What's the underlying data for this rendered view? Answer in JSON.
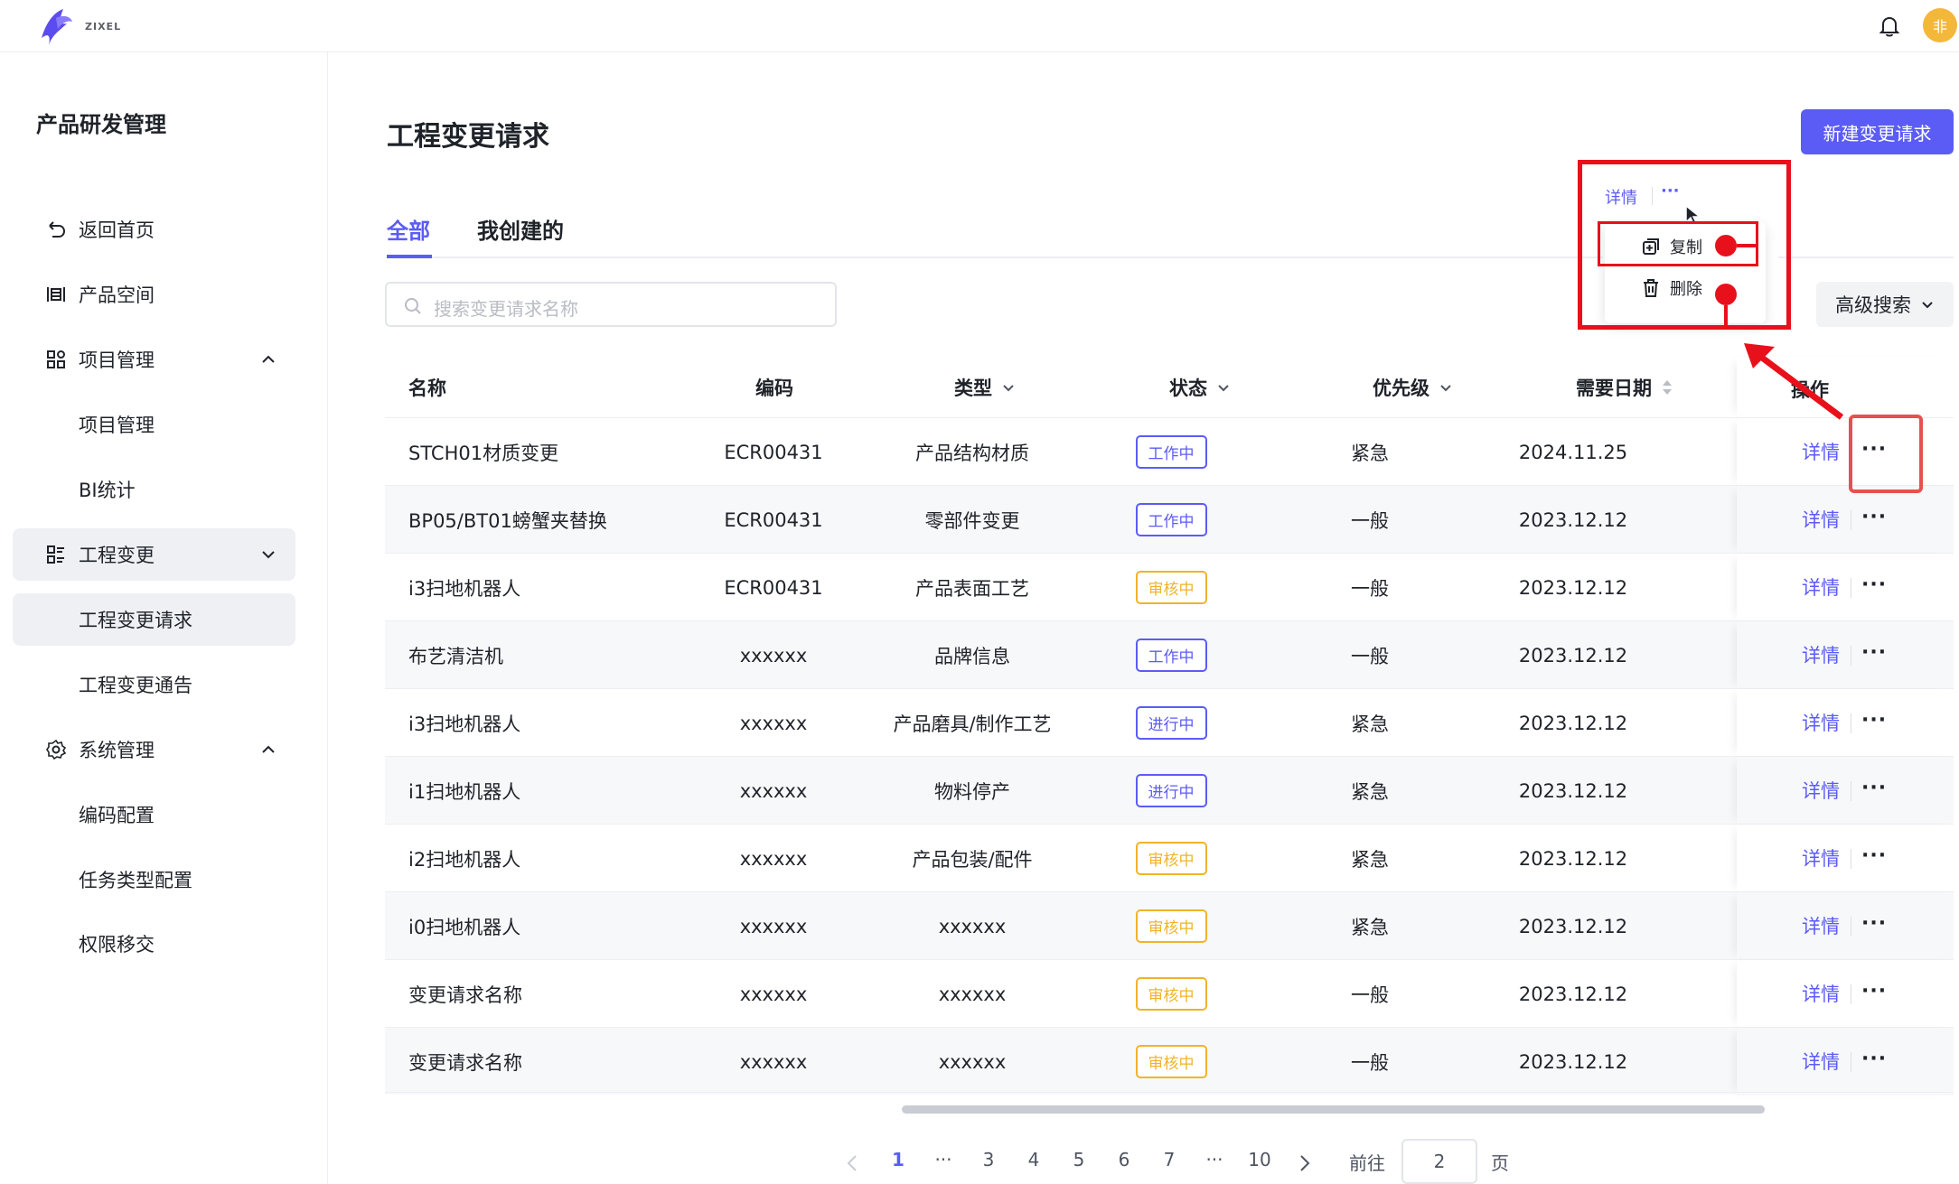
{
  "header": {
    "logo_text": "ZIXEL",
    "avatar_initial": "非"
  },
  "sidebar": {
    "title": "产品研发管理",
    "items": [
      {
        "label": "返回首页",
        "icon": "back-icon"
      },
      {
        "label": "产品空间",
        "icon": "product-space-icon"
      },
      {
        "label": "项目管理",
        "icon": "grid-icon",
        "expanded": true
      },
      {
        "label": "项目管理",
        "sub": true
      },
      {
        "label": "BI统计",
        "sub": true
      },
      {
        "label": "工程变更",
        "icon": "list-icon",
        "expanded": false
      },
      {
        "label": "工程变更请求",
        "sub": true,
        "active": true
      },
      {
        "label": "工程变更通告",
        "sub": true
      },
      {
        "label": "系统管理",
        "icon": "gear-icon",
        "expanded": true
      },
      {
        "label": "编码配置",
        "sub": true
      },
      {
        "label": "任务类型配置",
        "sub": true
      },
      {
        "label": "权限移交",
        "sub": true
      }
    ]
  },
  "main": {
    "title": "工程变更请求",
    "new_button": "新建变更请求",
    "tabs": [
      {
        "label": "全部",
        "active": true
      },
      {
        "label": "我创建的",
        "active": false
      }
    ],
    "search_placeholder": "搜索变更请求名称",
    "advanced_search": "高级搜索"
  },
  "table": {
    "columns": [
      "名称",
      "编码",
      "类型",
      "状态",
      "优先级",
      "需要日期",
      "操作"
    ],
    "rows": [
      {
        "name": "STCH01材质变更",
        "code": "ECR00431",
        "type": "产品结构材质",
        "status": "工作中",
        "priority": "紧急",
        "date": "2024.11.25"
      },
      {
        "name": "BP05/BT01螃蟹夹替换",
        "code": "ECR00431",
        "type": "零部件变更",
        "status": "工作中",
        "priority": "一般",
        "date": "2023.12.12"
      },
      {
        "name": "i3扫地机器人",
        "code": "ECR00431",
        "type": "产品表面工艺",
        "status": "审核中",
        "priority": "一般",
        "date": "2023.12.12"
      },
      {
        "name": "布艺清洁机",
        "code": "xxxxxx",
        "type": "品牌信息",
        "status": "工作中",
        "priority": "一般",
        "date": "2023.12.12"
      },
      {
        "name": "i3扫地机器人",
        "code": "xxxxxx",
        "type": "产品磨具/制作工艺",
        "status": "进行中",
        "priority": "紧急",
        "date": "2023.12.12"
      },
      {
        "name": "i1扫地机器人",
        "code": "xxxxxx",
        "type": "物料停产",
        "status": "进行中",
        "priority": "紧急",
        "date": "2023.12.12"
      },
      {
        "name": "i2扫地机器人",
        "code": "xxxxxx",
        "type": "产品包装/配件",
        "status": "审核中",
        "priority": "紧急",
        "date": "2023.12.12"
      },
      {
        "name": "i0扫地机器人",
        "code": "xxxxxx",
        "type": "xxxxxx",
        "status": "审核中",
        "priority": "紧急",
        "date": "2023.12.12"
      },
      {
        "name": "变更请求名称",
        "code": "xxxxxx",
        "type": "xxxxxx",
        "status": "审核中",
        "priority": "一般",
        "date": "2023.12.12"
      },
      {
        "name": "变更请求名称",
        "code": "xxxxxx",
        "type": "xxxxxx",
        "status": "审核中",
        "priority": "一般",
        "date": "2023.12.12"
      }
    ],
    "action_detail": "详情",
    "action_more": "···"
  },
  "status_colors": {
    "工作中": "#5b5cf6",
    "进行中": "#5b5cf6",
    "审核中": "#f0b429"
  },
  "pagination": {
    "pages": [
      "1",
      "···",
      "3",
      "4",
      "5",
      "6",
      "7",
      "···",
      "10"
    ],
    "current": "1",
    "goto_label": "前往",
    "goto_value": "2",
    "page_suffix": "页"
  },
  "popover": {
    "detail": "详情",
    "more": "···",
    "menu": [
      {
        "label": "复制",
        "icon": "copy-icon"
      },
      {
        "label": "删除",
        "icon": "trash-icon"
      }
    ]
  }
}
